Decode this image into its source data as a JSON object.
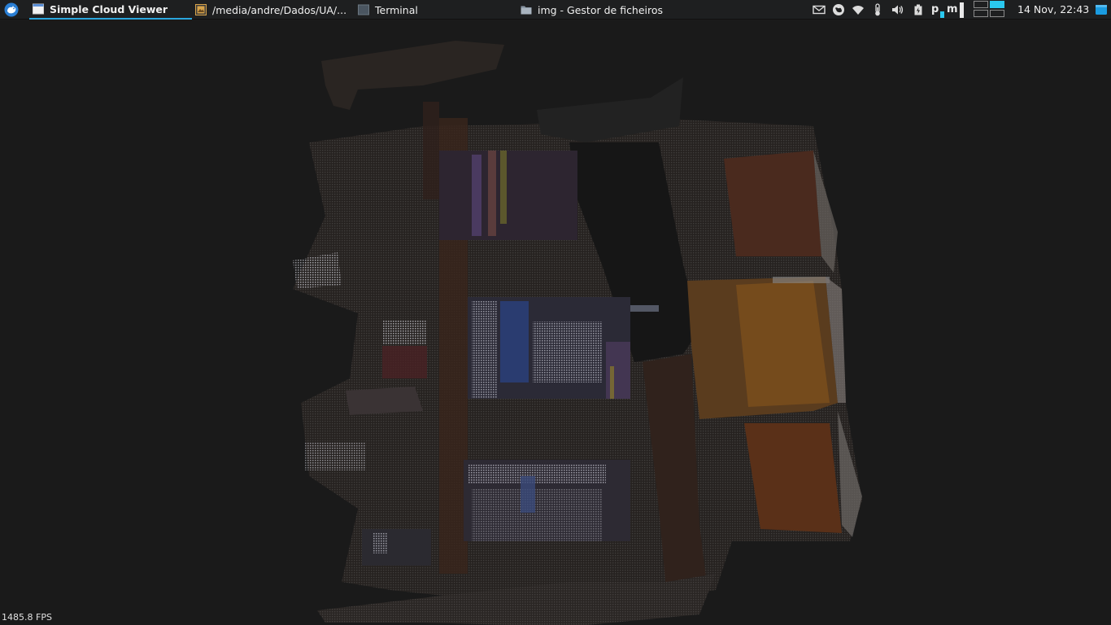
{
  "panel": {
    "menu_icon": "xfce-mouse-icon",
    "tasks": [
      {
        "label": "Simple Cloud Viewer",
        "icon": "window-icon",
        "active": true
      },
      {
        "label": "/media/andre/Dados/UA/...",
        "icon": "image-file-icon",
        "active": false
      },
      {
        "label": "Terminal",
        "icon": "terminal-icon",
        "active": false
      },
      {
        "label": "img - Gestor de ficheiros",
        "icon": "folder-icon",
        "active": false
      }
    ],
    "tray": {
      "icons": [
        "mail-icon",
        "network-globe-icon",
        "wifi-icon",
        "thermometer-icon",
        "volume-icon",
        "battery-icon"
      ],
      "sysmon_labels": [
        "p",
        "m"
      ],
      "clock": "14 Nov, 22:43",
      "show_desktop_icon": "show-desktop-icon"
    },
    "accent_color": "#2aa6de"
  },
  "viewer": {
    "fps": "1485.8 FPS",
    "background_color": "#1a1a1a"
  }
}
